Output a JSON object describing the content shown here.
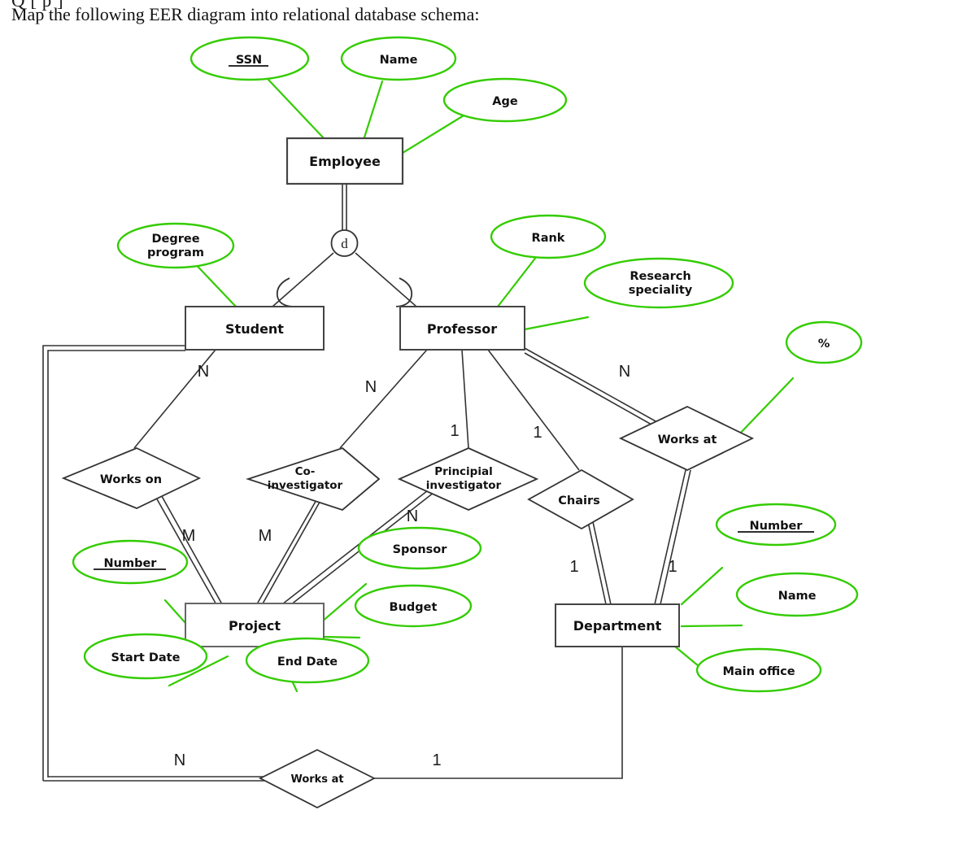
{
  "page": {
    "clipped_top_line": "Q              [         p           ]",
    "prompt": "Map the following EER diagram into relational database schema:"
  },
  "colors": {
    "attribute_green": "#33cc00",
    "line_black": "#333333",
    "entity_border": "#444444",
    "text": "#111111"
  },
  "diagram": {
    "type": "EER",
    "entities": [
      {
        "id": "employee",
        "label": "Employee"
      },
      {
        "id": "student",
        "label": "Student"
      },
      {
        "id": "professor",
        "label": "Professor"
      },
      {
        "id": "project",
        "label": "Project"
      },
      {
        "id": "department",
        "label": "Department"
      }
    ],
    "specialization": {
      "symbol": "d",
      "kind": "disjoint",
      "superclass": "Employee",
      "subclasses": [
        "Student",
        "Professor"
      ],
      "participation": "total"
    },
    "relationships": [
      {
        "id": "works-on",
        "label": "Works on",
        "label_line1": "Works on",
        "label_line2": ""
      },
      {
        "id": "co-inv",
        "label": "Co-investigator",
        "label_line1": "Co-",
        "label_line2": "investigator"
      },
      {
        "id": "pi",
        "label": "Principial investigator",
        "label_line1": "Principial",
        "label_line2": "investigator"
      },
      {
        "id": "chairs",
        "label": "Chairs",
        "label_line1": "Chairs",
        "label_line2": ""
      },
      {
        "id": "works-at-prof",
        "label": "Works at",
        "label_line1": "Works at",
        "label_line2": ""
      },
      {
        "id": "works-at-stu",
        "label": "Works at",
        "label_line1": "Works at",
        "label_line2": ""
      }
    ],
    "attributes": [
      {
        "id": "ssn",
        "label": "SSN",
        "owner": "Employee",
        "key": true,
        "line1": "SSN",
        "line2": ""
      },
      {
        "id": "emp-name",
        "label": "Name",
        "owner": "Employee",
        "key": false,
        "line1": "Name",
        "line2": ""
      },
      {
        "id": "age",
        "label": "Age",
        "owner": "Employee",
        "key": false,
        "line1": "Age",
        "line2": ""
      },
      {
        "id": "degree",
        "label": "Degree program",
        "owner": "Student",
        "key": false,
        "line1": "Degree",
        "line2": "program"
      },
      {
        "id": "rank",
        "label": "Rank",
        "owner": "Professor",
        "key": false,
        "line1": "Rank",
        "line2": ""
      },
      {
        "id": "res-spec",
        "label": "Research speciality",
        "owner": "Professor",
        "key": false,
        "line1": "Research",
        "line2": "speciality"
      },
      {
        "id": "pct",
        "label": "%",
        "owner": "Works at",
        "key": false,
        "line1": "%",
        "line2": ""
      },
      {
        "id": "proj-num",
        "label": "Number",
        "owner": "Project",
        "key": true,
        "line1": "Number",
        "line2": ""
      },
      {
        "id": "sponsor",
        "label": "Sponsor",
        "owner": "Project",
        "key": false,
        "line1": "Sponsor",
        "line2": ""
      },
      {
        "id": "budget",
        "label": "Budget",
        "owner": "Project",
        "key": false,
        "line1": "Budget",
        "line2": ""
      },
      {
        "id": "start-date",
        "label": "Start Date",
        "owner": "Project",
        "key": false,
        "line1": "Start Date",
        "line2": ""
      },
      {
        "id": "end-date",
        "label": "End Date",
        "owner": "Project",
        "key": false,
        "line1": "End Date",
        "line2": ""
      },
      {
        "id": "dept-num",
        "label": "Number",
        "owner": "Department",
        "key": true,
        "line1": "Number",
        "line2": ""
      },
      {
        "id": "dept-name",
        "label": "Name",
        "owner": "Department",
        "key": false,
        "line1": "Name",
        "line2": ""
      },
      {
        "id": "main-office",
        "label": "Main office",
        "owner": "Department",
        "key": false,
        "line1": "Main office",
        "line2": ""
      }
    ],
    "cardinalities": [
      {
        "id": "c-stu-workson",
        "value": "N",
        "edge": "Student -> Works on"
      },
      {
        "id": "c-prof-coinv",
        "value": "N",
        "edge": "Professor -> Co-investigator"
      },
      {
        "id": "c-prof-pi",
        "value": "1",
        "edge": "Professor -> Principial investigator"
      },
      {
        "id": "c-prof-chairs",
        "value": "1",
        "edge": "Professor -> Chairs"
      },
      {
        "id": "c-prof-worksat",
        "value": "N",
        "edge": "Professor -> Works at"
      },
      {
        "id": "c-workson-proj",
        "value": "M",
        "edge": "Works on -> Project"
      },
      {
        "id": "c-coinv-proj",
        "value": "M",
        "edge": "Co-investigator -> Project"
      },
      {
        "id": "c-pi-proj",
        "value": "N",
        "edge": "Principial investigator -> Project"
      },
      {
        "id": "c-chairs-dept",
        "value": "1",
        "edge": "Chairs -> Department"
      },
      {
        "id": "c-worksat-dept",
        "value": "1",
        "edge": "Works at -> Department"
      },
      {
        "id": "c-stu-worksat",
        "value": "N",
        "edge": "Student -> Works at (bottom)"
      },
      {
        "id": "c-worksat2-dept",
        "value": "1",
        "edge": "Works at (bottom) -> Department"
      }
    ]
  }
}
